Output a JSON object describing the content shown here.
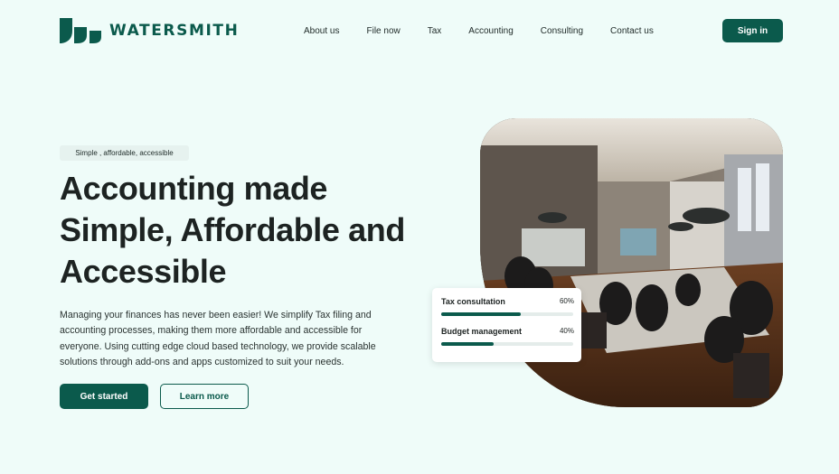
{
  "brand": {
    "name": "WATERSMITH",
    "color": "#0b5a4c"
  },
  "nav": {
    "items": [
      {
        "label": "About us"
      },
      {
        "label": "File now"
      },
      {
        "label": "Tax"
      },
      {
        "label": "Accounting"
      },
      {
        "label": "Consulting"
      },
      {
        "label": "Contact us"
      }
    ],
    "signin_label": "Sign in"
  },
  "hero": {
    "tagline": "Simple , affordable, accessible",
    "headline": [
      "Accounting made",
      "Simple, Affordable and",
      "Accessible"
    ],
    "description": "Managing your finances has never been easier! We simplify Tax filing and accounting processes, making them more affordable and accessible for everyone. Using cutting edge cloud based technology, we provide scalable solutions through add-ons and apps customized to suit your needs.",
    "primary_cta": "Get started",
    "secondary_cta": "Learn more"
  },
  "stats": [
    {
      "label": "Tax consultation",
      "percent_label": "60%",
      "percent": 60
    },
    {
      "label": "Budget management",
      "percent_label": "40%",
      "percent": 40
    }
  ],
  "colors": {
    "background": "#effcf9",
    "accent": "#0b5a4c"
  }
}
